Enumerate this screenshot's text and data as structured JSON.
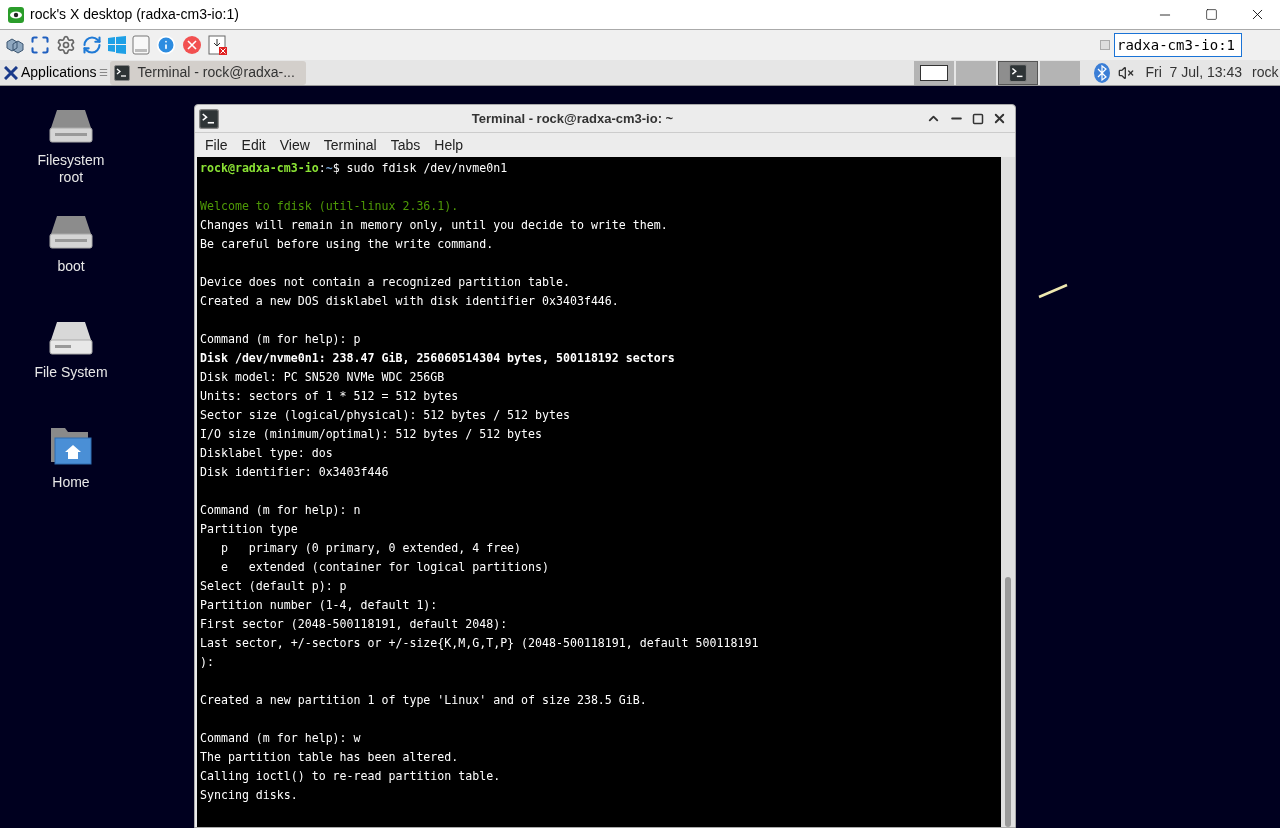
{
  "viewer": {
    "title": "rock's X desktop (radxa-cm3-io:1)",
    "host_checkbox": {
      "checked": false
    },
    "host_field": {
      "value": "radxa-cm3-io:1"
    }
  },
  "panel": {
    "applications": "Applications",
    "separator": "☰",
    "tasks": [
      {
        "label": "Terminal - rock@radxa-...",
        "selected": true
      }
    ],
    "workspaces": [
      {
        "kind": "window",
        "selected": false
      },
      {
        "kind": "empty",
        "selected": false
      },
      {
        "kind": "terminal",
        "selected": true
      },
      {
        "kind": "empty",
        "selected": false
      }
    ],
    "clock": "Fri  7 Jul, 13:43",
    "user": "rock"
  },
  "desktop_icons": [
    {
      "kind": "drive",
      "label": "Filesystem root"
    },
    {
      "kind": "drive",
      "label": "boot"
    },
    {
      "kind": "disk",
      "label": "File System"
    },
    {
      "kind": "home",
      "label": "Home"
    }
  ],
  "terminal": {
    "title": "Terminal - rock@radxa-cm3-io: ~",
    "menu": [
      "File",
      "Edit",
      "View",
      "Terminal",
      "Tabs",
      "Help"
    ],
    "lines": [
      {
        "kind": "prompt",
        "user": "rock@radxa-cm3-io",
        "sep": ":",
        "path": "~",
        "command": "$ sudo fdisk /dev/nvme0n1"
      },
      {
        "kind": "blank"
      },
      {
        "kind": "green",
        "text": "Welcome to fdisk (util-linux 2.36.1)."
      },
      {
        "kind": "plain",
        "text": "Changes will remain in memory only, until you decide to write them."
      },
      {
        "kind": "plain",
        "text": "Be careful before using the write command."
      },
      {
        "kind": "blank"
      },
      {
        "kind": "plain",
        "text": "Device does not contain a recognized partition table."
      },
      {
        "kind": "plain",
        "text": "Created a new DOS disklabel with disk identifier 0x3403f446."
      },
      {
        "kind": "blank"
      },
      {
        "kind": "plain",
        "text": "Command (m for help): p"
      },
      {
        "kind": "bold",
        "text": "Disk /dev/nvme0n1: 238.47 GiB, 256060514304 bytes, 500118192 sectors"
      },
      {
        "kind": "plain",
        "text": "Disk model: PC SN520 NVMe WDC 256GB"
      },
      {
        "kind": "plain",
        "text": "Units: sectors of 1 * 512 = 512 bytes"
      },
      {
        "kind": "plain",
        "text": "Sector size (logical/physical): 512 bytes / 512 bytes"
      },
      {
        "kind": "plain",
        "text": "I/O size (minimum/optimal): 512 bytes / 512 bytes"
      },
      {
        "kind": "plain",
        "text": "Disklabel type: dos"
      },
      {
        "kind": "plain",
        "text": "Disk identifier: 0x3403f446"
      },
      {
        "kind": "blank"
      },
      {
        "kind": "plain",
        "text": "Command (m for help): n"
      },
      {
        "kind": "plain",
        "text": "Partition type"
      },
      {
        "kind": "plain",
        "text": "   p   primary (0 primary, 0 extended, 4 free)"
      },
      {
        "kind": "plain",
        "text": "   e   extended (container for logical partitions)"
      },
      {
        "kind": "plain",
        "text": "Select (default p): p"
      },
      {
        "kind": "plain",
        "text": "Partition number (1-4, default 1):"
      },
      {
        "kind": "plain",
        "text": "First sector (2048-500118191, default 2048):"
      },
      {
        "kind": "plain",
        "text": "Last sector, +/-sectors or +/-size{K,M,G,T,P} (2048-500118191, default 500118191"
      },
      {
        "kind": "plain",
        "text": "):"
      },
      {
        "kind": "blank"
      },
      {
        "kind": "plain",
        "text": "Created a new partition 1 of type 'Linux' and of size 238.5 GiB."
      },
      {
        "kind": "blank"
      },
      {
        "kind": "plain",
        "text": "Command (m for help): w"
      },
      {
        "kind": "plain",
        "text": "The partition table has been altered."
      },
      {
        "kind": "plain",
        "text": "Calling ioctl() to re-read partition table."
      },
      {
        "kind": "plain",
        "text": "Syncing disks."
      }
    ]
  }
}
